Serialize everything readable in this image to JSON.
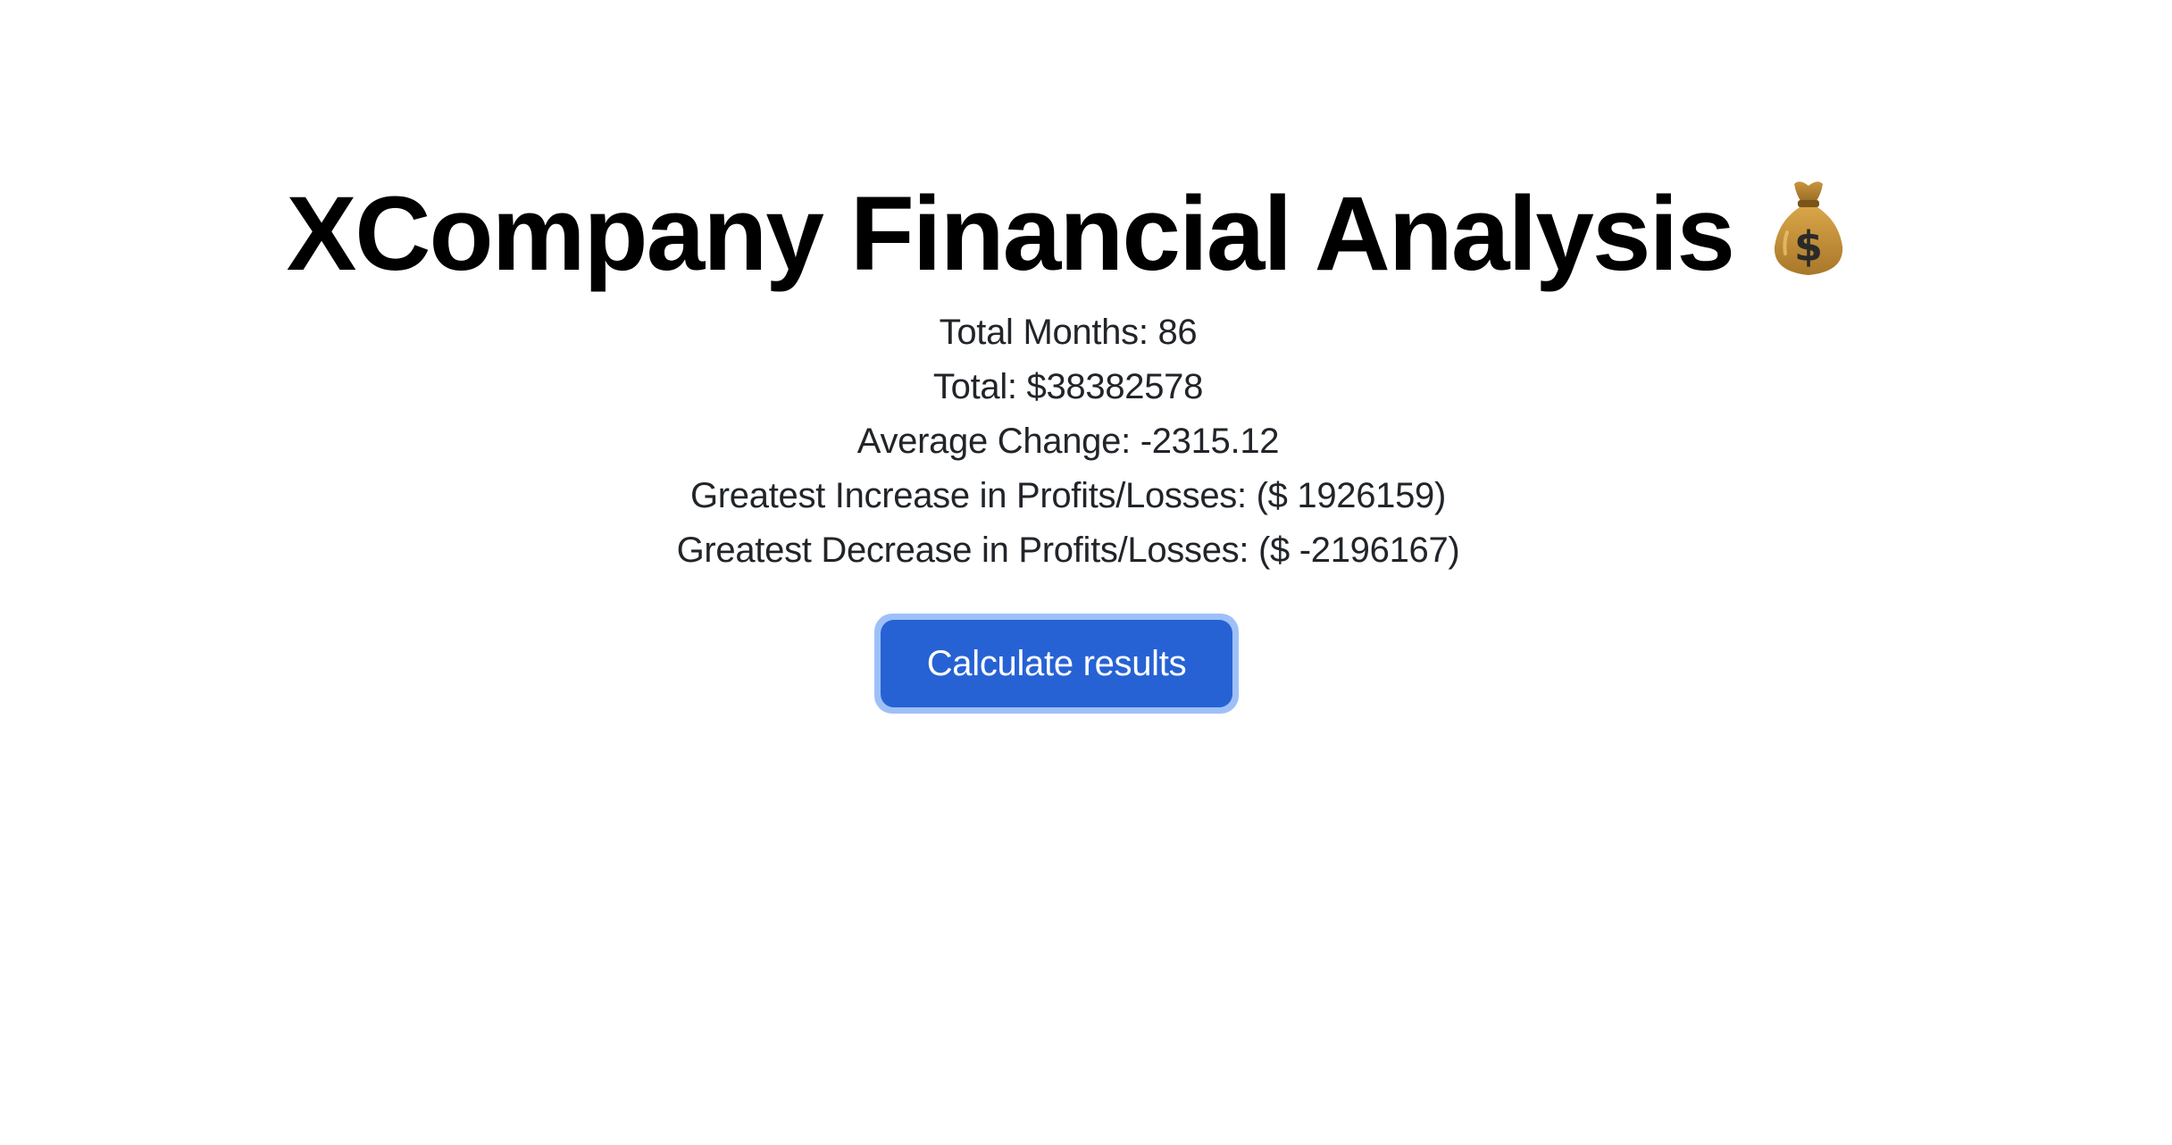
{
  "header": {
    "title": "XCompany Financial Analysis",
    "title_icon": "money-bag-icon"
  },
  "stats": {
    "total_months": "Total Months: 86",
    "total": "Total: $38382578",
    "average_change": "Average Change: -2315.12",
    "greatest_increase": "Greatest Increase in Profits/Losses: ($ 1926159)",
    "greatest_decrease": "Greatest Decrease in Profits/Losses: ($ -2196167)"
  },
  "actions": {
    "calculate_label": "Calculate results"
  },
  "colors": {
    "button_bg": "#2762d4",
    "button_focus_ring": "#9ec0f8",
    "title_text": "#000000",
    "body_text": "#212529"
  }
}
